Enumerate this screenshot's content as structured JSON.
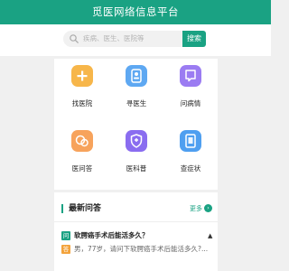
{
  "header": {
    "title": "觅医网络信息平台"
  },
  "search": {
    "placeholder": "疾病、医生、医院等",
    "button_label": "搜索"
  },
  "grid": {
    "items": [
      {
        "label": "找医院",
        "icon": "plus-icon",
        "color": "#f7b64a"
      },
      {
        "label": "寻医生",
        "icon": "doctor-icon",
        "color": "#5ea8f2"
      },
      {
        "label": "问病情",
        "icon": "chat-icon",
        "color": "#9b7cf2"
      },
      {
        "label": "医问答",
        "icon": "qa-icon",
        "color": "#f7a35c"
      },
      {
        "label": "医科普",
        "icon": "shield-icon",
        "color": "#8a6df0"
      },
      {
        "label": "查症状",
        "icon": "document-icon",
        "color": "#4f9ff0"
      }
    ]
  },
  "qa_section": {
    "title": "最新问答",
    "more_label": "更多",
    "items": [
      {
        "badge": "问",
        "badge_color": "#1aa283",
        "text": "软腭癌手术后能活多久？"
      },
      {
        "badge": "答",
        "badge_color": "#f3a33c",
        "text": "男，77岁，请问下软腭癌手术后能活多久?..."
      }
    ]
  }
}
